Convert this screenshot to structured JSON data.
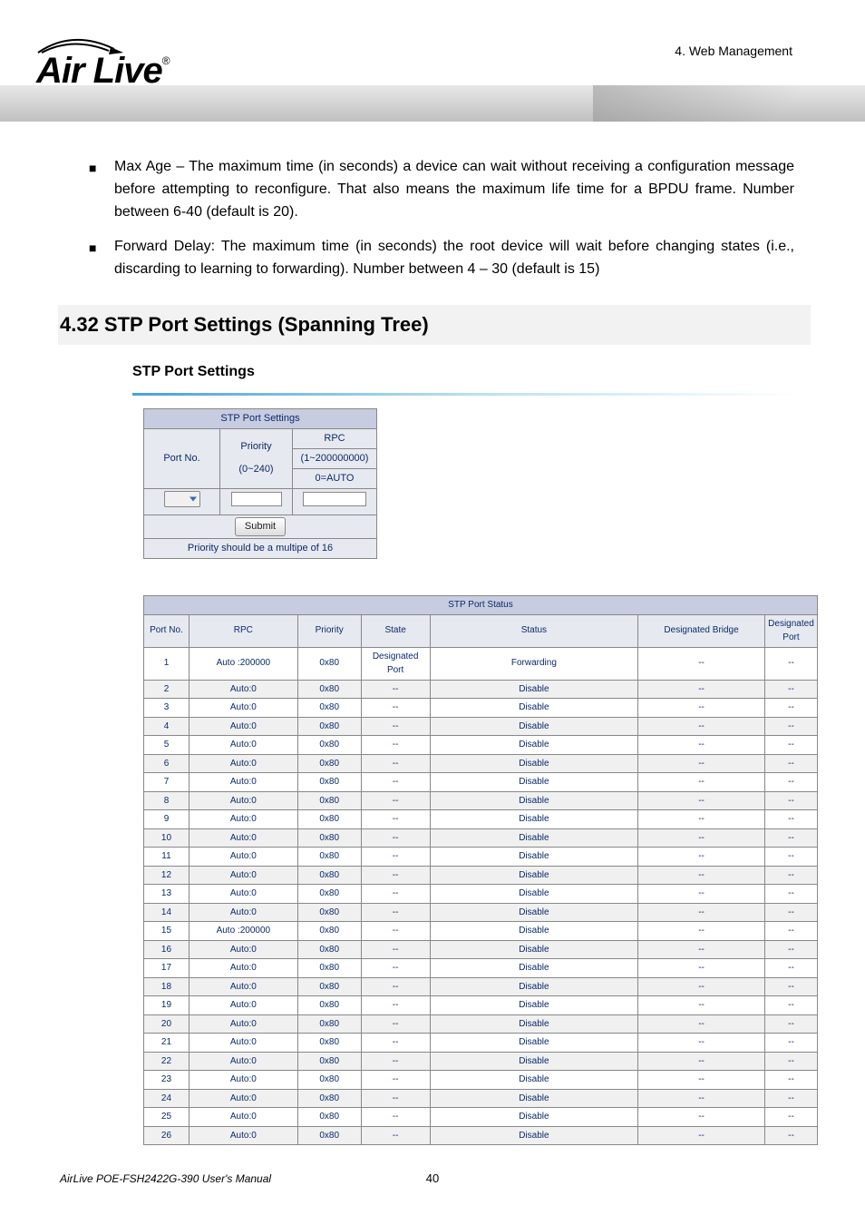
{
  "header": {
    "chapter": "4. Web Management"
  },
  "logo": {
    "text": "Air Live"
  },
  "bullets": [
    "Max Age – The maximum time (in seconds) a device can wait without receiving a configuration message before attempting to reconfigure. That also means the maximum life time for a BPDU frame. Number between 6-40 (default is 20).",
    "Forward Delay: The maximum time (in seconds) the root device will wait before changing states (i.e., discarding to learning to forwarding). Number between 4 – 30 (default is 15)"
  ],
  "section_heading": "4.32 STP Port Settings (Spanning Tree)",
  "sub_heading": "STP Port Settings",
  "settings": {
    "caption": "STP Port Settings",
    "col_portno": "Port No.",
    "col_priority_l1": "Priority",
    "col_priority_l2": "(0~240)",
    "col_rpc": "RPC",
    "col_rpc_l2": "(1~200000000)",
    "col_rpc_l3": "0=AUTO",
    "submit": "Submit",
    "note": "Priority should be a multipe of 16"
  },
  "status": {
    "caption": "STP Port Status",
    "headers": {
      "portno": "Port No.",
      "rpc": "RPC",
      "priority": "Priority",
      "state": "State",
      "status": "Status",
      "db": "Designated Bridge",
      "dp_l1": "Designated",
      "dp_l2": "Port"
    },
    "rows": [
      {
        "port": "1",
        "rpc": "Auto :200000",
        "prio": "0x80",
        "state": "Designated Port",
        "status": "Forwarding",
        "db": "--",
        "dp": "--"
      },
      {
        "port": "2",
        "rpc": "Auto:0",
        "prio": "0x80",
        "state": "--",
        "status": "Disable",
        "db": "--",
        "dp": "--"
      },
      {
        "port": "3",
        "rpc": "Auto:0",
        "prio": "0x80",
        "state": "--",
        "status": "Disable",
        "db": "--",
        "dp": "--"
      },
      {
        "port": "4",
        "rpc": "Auto:0",
        "prio": "0x80",
        "state": "--",
        "status": "Disable",
        "db": "--",
        "dp": "--"
      },
      {
        "port": "5",
        "rpc": "Auto:0",
        "prio": "0x80",
        "state": "--",
        "status": "Disable",
        "db": "--",
        "dp": "--"
      },
      {
        "port": "6",
        "rpc": "Auto:0",
        "prio": "0x80",
        "state": "--",
        "status": "Disable",
        "db": "--",
        "dp": "--"
      },
      {
        "port": "7",
        "rpc": "Auto:0",
        "prio": "0x80",
        "state": "--",
        "status": "Disable",
        "db": "--",
        "dp": "--"
      },
      {
        "port": "8",
        "rpc": "Auto:0",
        "prio": "0x80",
        "state": "--",
        "status": "Disable",
        "db": "--",
        "dp": "--"
      },
      {
        "port": "9",
        "rpc": "Auto:0",
        "prio": "0x80",
        "state": "--",
        "status": "Disable",
        "db": "--",
        "dp": "--"
      },
      {
        "port": "10",
        "rpc": "Auto:0",
        "prio": "0x80",
        "state": "--",
        "status": "Disable",
        "db": "--",
        "dp": "--"
      },
      {
        "port": "11",
        "rpc": "Auto:0",
        "prio": "0x80",
        "state": "--",
        "status": "Disable",
        "db": "--",
        "dp": "--"
      },
      {
        "port": "12",
        "rpc": "Auto:0",
        "prio": "0x80",
        "state": "--",
        "status": "Disable",
        "db": "--",
        "dp": "--"
      },
      {
        "port": "13",
        "rpc": "Auto:0",
        "prio": "0x80",
        "state": "--",
        "status": "Disable",
        "db": "--",
        "dp": "--"
      },
      {
        "port": "14",
        "rpc": "Auto:0",
        "prio": "0x80",
        "state": "--",
        "status": "Disable",
        "db": "--",
        "dp": "--"
      },
      {
        "port": "15",
        "rpc": "Auto :200000",
        "prio": "0x80",
        "state": "--",
        "status": "Disable",
        "db": "--",
        "dp": "--"
      },
      {
        "port": "16",
        "rpc": "Auto:0",
        "prio": "0x80",
        "state": "--",
        "status": "Disable",
        "db": "--",
        "dp": "--"
      },
      {
        "port": "17",
        "rpc": "Auto:0",
        "prio": "0x80",
        "state": "--",
        "status": "Disable",
        "db": "--",
        "dp": "--"
      },
      {
        "port": "18",
        "rpc": "Auto:0",
        "prio": "0x80",
        "state": "--",
        "status": "Disable",
        "db": "--",
        "dp": "--"
      },
      {
        "port": "19",
        "rpc": "Auto:0",
        "prio": "0x80",
        "state": "--",
        "status": "Disable",
        "db": "--",
        "dp": "--"
      },
      {
        "port": "20",
        "rpc": "Auto:0",
        "prio": "0x80",
        "state": "--",
        "status": "Disable",
        "db": "--",
        "dp": "--"
      },
      {
        "port": "21",
        "rpc": "Auto:0",
        "prio": "0x80",
        "state": "--",
        "status": "Disable",
        "db": "--",
        "dp": "--"
      },
      {
        "port": "22",
        "rpc": "Auto:0",
        "prio": "0x80",
        "state": "--",
        "status": "Disable",
        "db": "--",
        "dp": "--"
      },
      {
        "port": "23",
        "rpc": "Auto:0",
        "prio": "0x80",
        "state": "--",
        "status": "Disable",
        "db": "--",
        "dp": "--"
      },
      {
        "port": "24",
        "rpc": "Auto:0",
        "prio": "0x80",
        "state": "--",
        "status": "Disable",
        "db": "--",
        "dp": "--"
      },
      {
        "port": "25",
        "rpc": "Auto:0",
        "prio": "0x80",
        "state": "--",
        "status": "Disable",
        "db": "--",
        "dp": "--"
      },
      {
        "port": "26",
        "rpc": "Auto:0",
        "prio": "0x80",
        "state": "--",
        "status": "Disable",
        "db": "--",
        "dp": "--"
      }
    ]
  },
  "footer": {
    "manual": "AirLive POE-FSH2422G-390 User's Manual",
    "page": "40"
  }
}
